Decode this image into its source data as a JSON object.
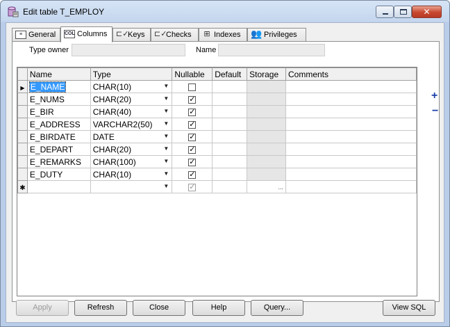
{
  "window": {
    "title": "Edit table T_EMPLOY",
    "close_glyph": "✕"
  },
  "tabs": [
    {
      "label": "General",
      "icon": "general-icon"
    },
    {
      "label": "Columns",
      "icon": "columns-icon",
      "icon_text": "COL"
    },
    {
      "label": "Keys",
      "icon": "keys-icon"
    },
    {
      "label": "Checks",
      "icon": "checks-icon"
    },
    {
      "label": "Indexes",
      "icon": "indexes-icon"
    },
    {
      "label": "Privileges",
      "icon": "privileges-icon"
    }
  ],
  "form": {
    "type_owner_label": "Type owner",
    "type_owner_value": "",
    "name_label": "Name",
    "name_value": ""
  },
  "grid": {
    "headers": [
      "Name",
      "Type",
      "Nullable",
      "Default",
      "Storage",
      "Comments"
    ],
    "rows": [
      {
        "name": "E_NAME",
        "type": "CHAR(10)",
        "nullable": false
      },
      {
        "name": "E_NUMS",
        "type": "CHAR(20)",
        "nullable": true
      },
      {
        "name": "E_BIR",
        "type": "CHAR(40)",
        "nullable": true
      },
      {
        "name": "E_ADDRESS",
        "type": "VARCHAR2(50)",
        "nullable": true
      },
      {
        "name": "E_BIRDATE",
        "type": "DATE",
        "nullable": true
      },
      {
        "name": "E_DEPART",
        "type": "CHAR(20)",
        "nullable": true
      },
      {
        "name": "E_REMARKS",
        "type": "CHAR(100)",
        "nullable": true
      },
      {
        "name": "E_DUTY",
        "type": "CHAR(10)",
        "nullable": true
      }
    ],
    "current_row_marker": "▶",
    "new_row_marker": "✱",
    "dropdown_glyph": "▼",
    "check_glyph": "✓",
    "storage_ellipsis": "..."
  },
  "side": {
    "add_glyph": "+",
    "remove_glyph": "−"
  },
  "buttons": {
    "apply": "Apply",
    "refresh": "Refresh",
    "close": "Close",
    "help": "Help",
    "query": "Query...",
    "view_sql": "View SQL"
  }
}
